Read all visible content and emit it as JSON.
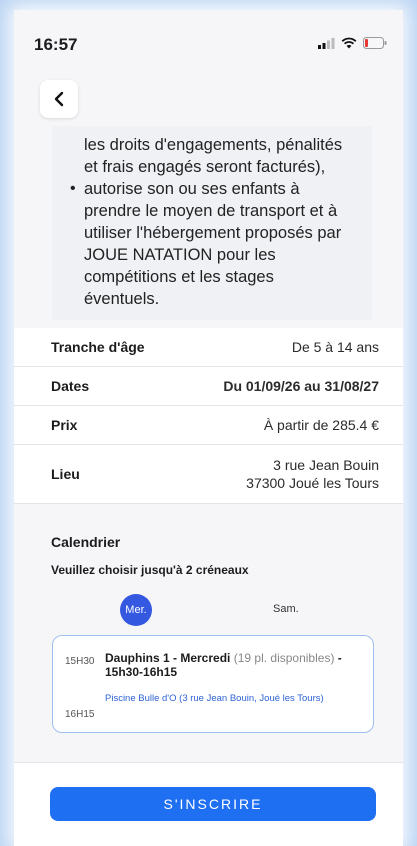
{
  "status_bar": {
    "time": "16:57"
  },
  "description": {
    "lines": [
      {
        "type": "text",
        "text": "les droits d'engagements, pénalités"
      },
      {
        "type": "text",
        "text": "et frais engagés seront facturés),"
      },
      {
        "type": "bullet",
        "text": "autorise son ou ses enfants à"
      },
      {
        "type": "text",
        "text": "prendre le moyen de transport et à"
      },
      {
        "type": "text",
        "text": "utiliser l'hébergement proposés par"
      },
      {
        "type": "text",
        "text": "JOUE NATATION pour les"
      },
      {
        "type": "text",
        "text": "compétitions et les stages"
      },
      {
        "type": "text",
        "text": "éventuels."
      }
    ]
  },
  "info": {
    "age_label": "Tranche d'âge",
    "age_value": "De 5 à 14 ans",
    "dates_label": "Dates",
    "dates_value": "Du 01/09/26 au 31/08/27",
    "price_label": "Prix",
    "price_value": "À partir de 285.4 €",
    "place_label": "Lieu",
    "place_line1": "3 rue Jean Bouin",
    "place_line2": "37300 Joué les Tours"
  },
  "calendar": {
    "title": "Calendrier",
    "subtitle": "Veuillez choisir jusqu'à 2 créneaux",
    "days": [
      "Mer.",
      "Sam."
    ],
    "selected_day": "Mer.",
    "slot": {
      "start": "15H30",
      "end": "16H15",
      "name": "Dauphins 1 - Mercredi",
      "places": "(19 pl. disponibles)",
      "name_suffix": "- 15h30-16h15",
      "location": "Piscine Bulle d'O (3 rue Jean Bouin, Joué les Tours)"
    }
  },
  "cta": {
    "label": "S'INSCRIRE"
  },
  "colors": {
    "accent": "#1e6ff2",
    "selected_day": "#3458e0",
    "link": "#2e63d6"
  }
}
